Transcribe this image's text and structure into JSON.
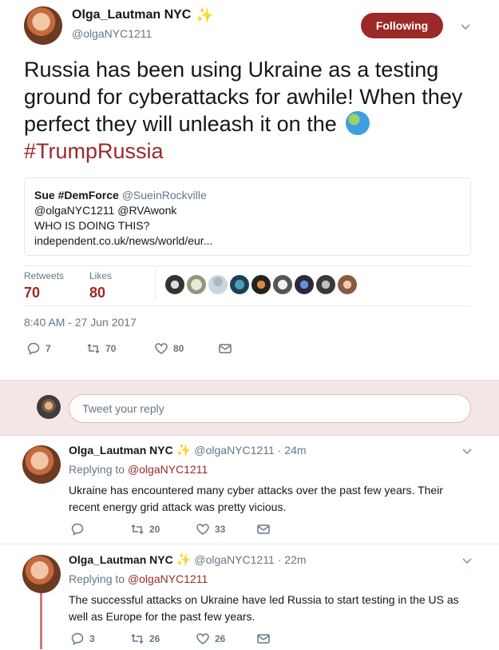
{
  "tweet": {
    "author_name": "Olga_Lautman NYC",
    "author_badge": "✨",
    "author_handle": "@olgaNYC1211",
    "follow_label": "Following",
    "text_main": "Russia has been using Ukraine as a testing ground for cyberattacks for awhile! When they perfect they will unleash it on the",
    "hashtag": "#TrumpRussia",
    "emoji": "globe-icon",
    "quote": {
      "name": "Sue #DemForce",
      "handle": "@SueinRockville",
      "line1": "@olgaNYC1211 @RVAwonk",
      "line2": "WHO IS DOING THIS?",
      "line3": "independent.co.uk/news/world/eur..."
    },
    "stats": {
      "retweets_label": "Retweets",
      "retweets_value": "70",
      "likes_label": "Likes",
      "likes_value": "80"
    },
    "timestamp": "8:40 AM - 27 Jun 2017",
    "actions": {
      "replies": "7",
      "retweets": "70",
      "likes": "80"
    }
  },
  "reply_box": {
    "placeholder": "Tweet your reply"
  },
  "replies": [
    {
      "name": "Olga_Lautman NYC",
      "badge": "✨",
      "handle": "@olgaNYC1211",
      "time": "· 24m",
      "replying_prefix": "Replying to",
      "replying_to": "@olgaNYC1211",
      "text": "Ukraine has encountered many cyber attacks over the past few years. Their recent energy grid attack was pretty vicious.",
      "replies": "",
      "retweets": "20",
      "likes": "33"
    },
    {
      "name": "Olga_Lautman NYC",
      "badge": "✨",
      "handle": "@olgaNYC1211",
      "time": "· 22m",
      "replying_prefix": "Replying to",
      "replying_to": "@olgaNYC1211",
      "text": "The successful attacks on Ukraine have led Russia to start testing in the US as well as Europe for the past few years.",
      "replies": "3",
      "retweets": "26",
      "likes": "26"
    }
  ],
  "colors": {
    "accent": "#9b2928",
    "muted": "#657786",
    "reply_bar": "#f5e6e6"
  }
}
